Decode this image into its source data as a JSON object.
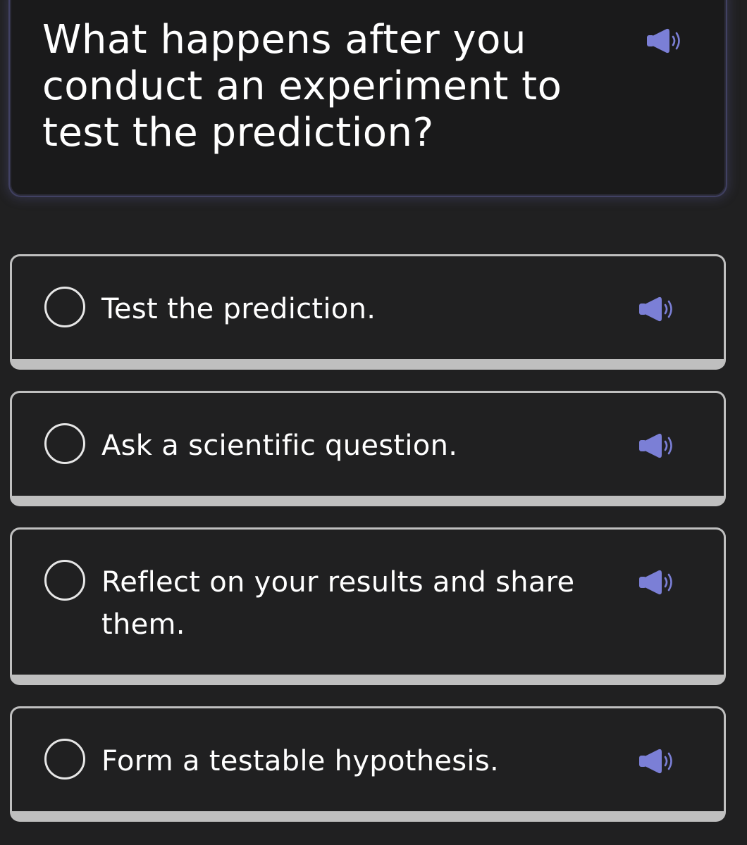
{
  "question": {
    "text": "What happens after you conduct an experiment to test the prediction?",
    "audio_icon": "speaker-icon"
  },
  "options": [
    {
      "label": "Test the prediction.",
      "selected": false,
      "audio_icon": "speaker-icon"
    },
    {
      "label": "Ask a scientific question.",
      "selected": false,
      "audio_icon": "speaker-icon"
    },
    {
      "label": "Reflect on your results and share them.",
      "selected": false,
      "audio_icon": "speaker-icon"
    },
    {
      "label": "Form a testable hypothesis.",
      "selected": false,
      "audio_icon": "speaker-icon"
    }
  ],
  "colors": {
    "background": "#202021",
    "accent_speaker": "#7b7fd6",
    "option_border": "#bfbfbf",
    "text": "#ffffff"
  }
}
